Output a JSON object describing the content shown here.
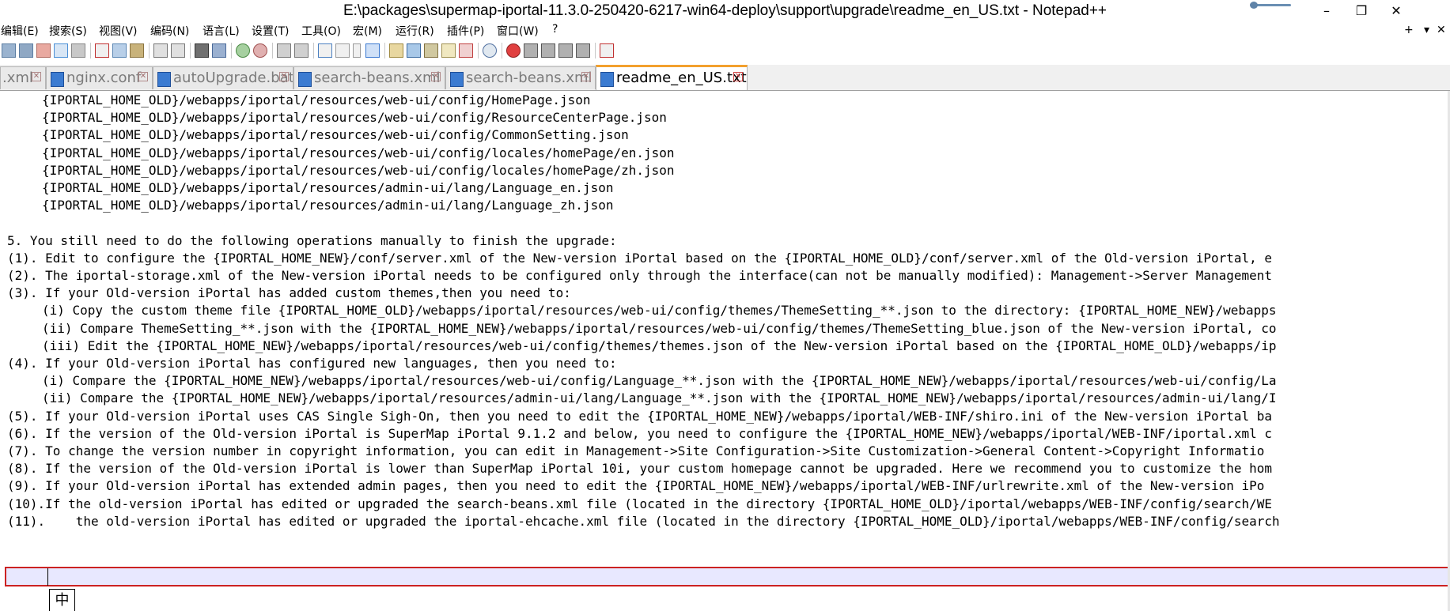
{
  "window": {
    "title": "E:\\packages\\supermap-iportal-11.3.0-250420-6217-win64-deploy\\support\\upgrade\\readme_en_US.txt - Notepad++",
    "controls": [
      "–",
      "❐",
      "✕"
    ]
  },
  "menu": {
    "items": [
      "编辑(E)",
      "搜索(S)",
      "视图(V)",
      "编码(N)",
      "语言(L)",
      "设置(T)",
      "工具(O)",
      "宏(M)",
      "运行(R)",
      "插件(P)",
      "窗口(W)",
      "?"
    ],
    "right": [
      "+",
      "▾",
      "✕"
    ]
  },
  "tabs": [
    {
      "label": ".xml",
      "active": false
    },
    {
      "label": "nginx.conf",
      "active": false
    },
    {
      "label": "autoUpgrade.bat",
      "active": false
    },
    {
      "label": "search-beans.xml",
      "active": false
    },
    {
      "label": "search-beans.xml",
      "active": false
    },
    {
      "label": "readme_en_US.txt",
      "active": true
    }
  ],
  "tab_close_glyph": "✕",
  "editor": {
    "lines": [
      {
        "text": "{IPORTAL_HOME_OLD}/webapps/iportal/resources/web-ui/config/HomePage.json",
        "indent": true
      },
      {
        "text": "{IPORTAL_HOME_OLD}/webapps/iportal/resources/web-ui/config/ResourceCenterPage.json",
        "indent": true
      },
      {
        "text": "{IPORTAL_HOME_OLD}/webapps/iportal/resources/web-ui/config/CommonSetting.json",
        "indent": true
      },
      {
        "text": "{IPORTAL_HOME_OLD}/webapps/iportal/resources/web-ui/config/locales/homePage/en.json",
        "indent": true
      },
      {
        "text": "{IPORTAL_HOME_OLD}/webapps/iportal/resources/web-ui/config/locales/homePage/zh.json",
        "indent": true
      },
      {
        "text": "{IPORTAL_HOME_OLD}/webapps/iportal/resources/admin-ui/lang/Language_en.json",
        "indent": true
      },
      {
        "text": "{IPORTAL_HOME_OLD}/webapps/iportal/resources/admin-ui/lang/Language_zh.json",
        "indent": true
      },
      {
        "text": "",
        "indent": false
      },
      {
        "text": "5. You still need to do the following operations manually to finish the upgrade:",
        "indent": false
      },
      {
        "text": "(1). Edit to configure the {IPORTAL_HOME_NEW}/conf/server.xml of the New-version iPortal based on the {IPORTAL_HOME_OLD}/conf/server.xml of the Old-version iPortal, e",
        "indent": false
      },
      {
        "text": "(2). The iportal-storage.xml of the New-version iPortal needs to be configured only through the interface(can not be manually modified): Management->Server Management",
        "indent": false
      },
      {
        "text": "(3). If your Old-version iPortal has added custom themes,then you need to:",
        "indent": false
      },
      {
        "text": "(i) Copy the custom theme file {IPORTAL_HOME_OLD}/webapps/iportal/resources/web-ui/config/themes/ThemeSetting_**.json to the directory: {IPORTAL_HOME_NEW}/webapps",
        "indent": true
      },
      {
        "text": "(ii) Compare ThemeSetting_**.json with the {IPORTAL_HOME_NEW}/webapps/iportal/resources/web-ui/config/themes/ThemeSetting_blue.json of the New-version iPortal, co",
        "indent": true
      },
      {
        "text": "(iii) Edit the {IPORTAL_HOME_NEW}/webapps/iportal/resources/web-ui/config/themes/themes.json of the New-version iPortal based on the {IPORTAL_HOME_OLD}/webapps/ip",
        "indent": true
      },
      {
        "text": "(4). If your Old-version iPortal has configured new languages, then you need to:",
        "indent": false
      },
      {
        "text": "(i) Compare the {IPORTAL_HOME_NEW}/webapps/iportal/resources/web-ui/config/Language_**.json with the {IPORTAL_HOME_NEW}/webapps/iportal/resources/web-ui/config/La",
        "indent": true
      },
      {
        "text": "(ii) Compare the {IPORTAL_HOME_NEW}/webapps/iportal/resources/admin-ui/lang/Language_**.json with the {IPORTAL_HOME_NEW}/webapps/iportal/resources/admin-ui/lang/I",
        "indent": true
      },
      {
        "text": "(5). If your Old-version iPortal uses CAS Single Sigh-On, then you need to edit the {IPORTAL_HOME_NEW}/webapps/iportal/WEB-INF/shiro.ini of the New-version iPortal ba",
        "indent": false
      },
      {
        "text": "(6). If the version of the Old-version iPortal is SuperMap iPortal 9.1.2 and below, you need to configure the {IPORTAL_HOME_NEW}/webapps/iportal/WEB-INF/iportal.xml c",
        "indent": false
      },
      {
        "text": "(7). To change the version number in copyright information, you can edit in Management->Site Configuration->Site Customization->General Content->Copyright Informatio",
        "indent": false
      },
      {
        "text": "(8). If the version of the Old-version iPortal is lower than SuperMap iPortal 10i, your custom homepage cannot be upgraded. Here we recommend you to customize the hom",
        "indent": false
      },
      {
        "text": "(9). If your Old-version iPortal has extended admin pages, then you need to edit the {IPORTAL_HOME_NEW}/webapps/iportal/WEB-INF/urlrewrite.xml of the New-version iPo",
        "indent": false
      },
      {
        "text": "(10).If the old-version iPortal has edited or upgraded the search-beans.xml file (located in the directory {IPORTAL_HOME_OLD}/iportal/webapps/WEB-INF/config/search/WE",
        "indent": false
      },
      {
        "text": "(11).    the old-version iPortal has edited or upgraded the iportal-ehcache.xml file (located in the directory {IPORTAL_HOME_OLD}/iportal/webapps/WEB-INF/config/search",
        "indent": false
      }
    ]
  },
  "ime_indicator": "中"
}
